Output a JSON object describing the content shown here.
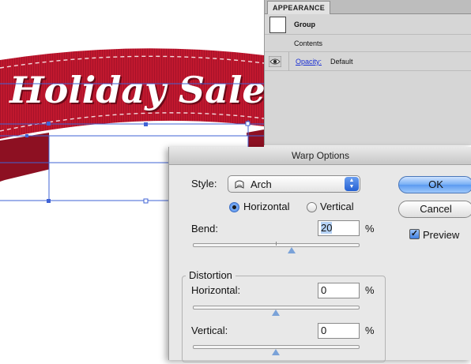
{
  "artwork": {
    "banner_text": "Holiday Sale!",
    "banner_color": "#c0182e",
    "selection_color": "#3f63d6"
  },
  "appearance_panel": {
    "tab_label": "APPEARANCE",
    "group_label": "Group",
    "contents_label": "Contents",
    "opacity_link": "Opacity:",
    "opacity_value": "Default"
  },
  "warp_dialog": {
    "title": "Warp Options",
    "style_label": "Style:",
    "style_value": "Arch",
    "style_icon": "arch-warp-icon",
    "orientation_options": [
      {
        "label": "Horizontal",
        "selected": true
      },
      {
        "label": "Vertical",
        "selected": false
      }
    ],
    "bend": {
      "label": "Bend:",
      "value": "20",
      "unit": "%",
      "percent": 20
    },
    "distortion": {
      "title": "Distortion",
      "horizontal": {
        "label": "Horizontal:",
        "value": "0",
        "unit": "%",
        "percent": 0
      },
      "vertical": {
        "label": "Vertical:",
        "value": "0",
        "unit": "%",
        "percent": 0
      }
    },
    "ok_label": "OK",
    "cancel_label": "Cancel",
    "preview_label": "Preview",
    "preview_checked": true
  }
}
